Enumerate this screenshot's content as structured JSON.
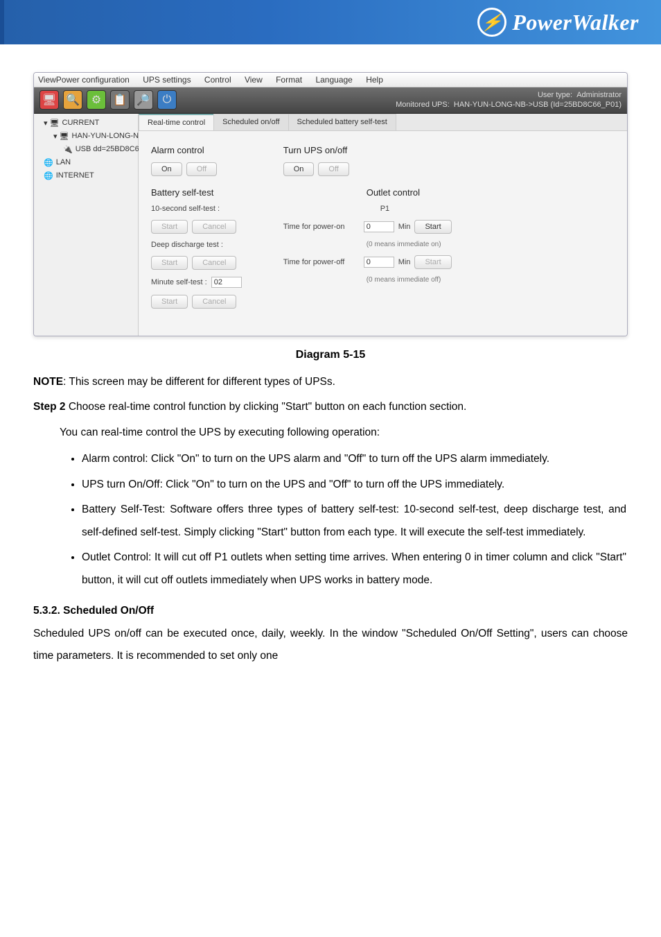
{
  "brand": "PowerWalker",
  "app": {
    "menu": [
      "ViewPower configuration",
      "UPS settings",
      "Control",
      "View",
      "Format",
      "Language",
      "Help"
    ],
    "status": {
      "user_label": "User type:",
      "user_value": "Administrator",
      "mon_label": "Monitored UPS:",
      "mon_value": "HAN-YUN-LONG-NB->USB (Id=25BD8C66_P01)"
    },
    "tree": {
      "current": "CURRENT",
      "node1": "HAN-YUN-LONG-NB",
      "node2": "USB dd=25BD8C6",
      "lan": "LAN",
      "internet": "INTERNET"
    },
    "tabs": [
      "Real-time control",
      "Scheduled on/off",
      "Scheduled battery self-test"
    ],
    "left": {
      "alarm_title": "Alarm control",
      "on": "On",
      "off": "Off",
      "battery_title": "Battery self-test",
      "ten_sec": "10-second self-test :",
      "start": "Start",
      "cancel": "Cancel",
      "deep": "Deep discharge test :",
      "minute": "Minute self-test :",
      "min_val": "02"
    },
    "right": {
      "turn_title": "Turn UPS on/off",
      "on": "On",
      "off": "Off",
      "outlet_title": "Outlet control",
      "p1": "P1",
      "row_on_label": "Time for power-on",
      "row_off_label": "Time for power-off",
      "zero": "0",
      "min": "Min",
      "start": "Start",
      "note_on": "(0 means immediate on)",
      "note_off": "(0 means immediate off)"
    }
  },
  "doc": {
    "diagram_caption": "Diagram 5-15",
    "note_line": "NOTE: This screen may be different for different types of UPSs.",
    "step2_a": "Step 2 ",
    "step2_b": "Choose real-time control function by clicking \"Start\" button on each function section.",
    "intro": "You can real-time control the UPS by executing following operation:",
    "bullets": [
      "Alarm control: Click \"On\" to turn on the UPS alarm and \"Off\" to turn off the UPS alarm immediately.",
      "UPS turn On/Off: Click \"On\" to turn on the UPS and \"Off\" to turn off the UPS immediately.",
      "Battery Self-Test: Software offers three types of battery self-test: 10-second self-test, deep discharge test, and self-defined self-test. Simply clicking \"Start\" button from each type. It will execute the self-test immediately.",
      "Outlet Control: It will cut off P1 outlets when setting time arrives. When entering 0 in timer column and click \"Start\" button, it will cut off outlets immediately when UPS works in battery mode."
    ],
    "h532": "5.3.2. Scheduled On/Off",
    "p532": "Scheduled UPS on/off can be executed once, daily, weekly. In the window \"Scheduled On/Off Setting\", users can choose time parameters. It is recommended to set only one"
  }
}
